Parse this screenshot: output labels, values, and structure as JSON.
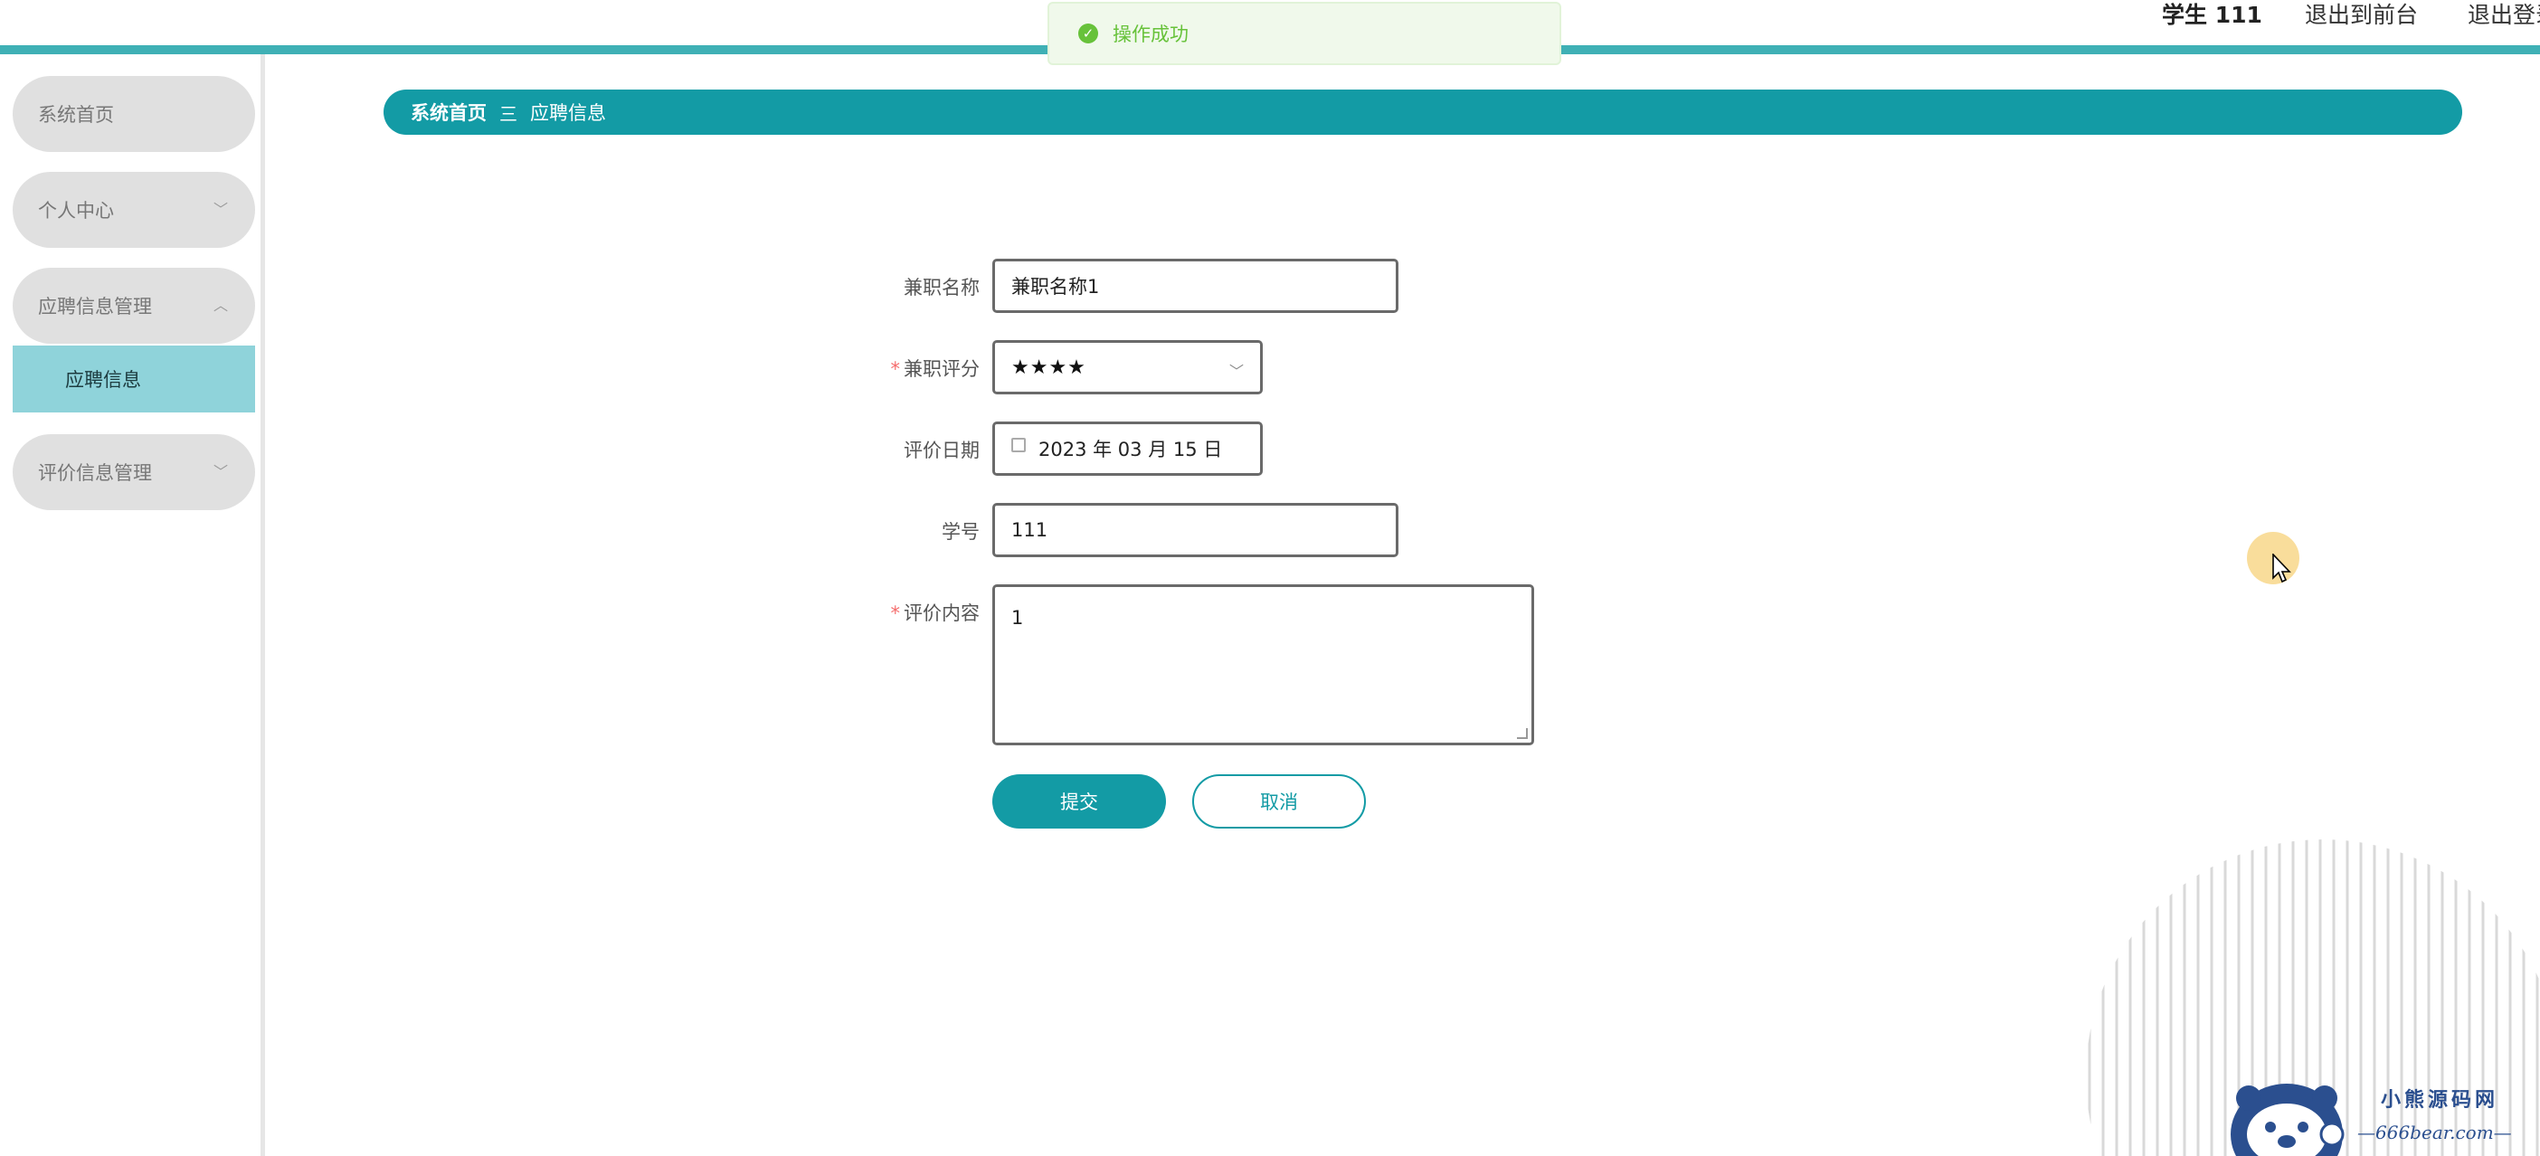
{
  "header": {
    "user_name": "学生 111",
    "to_front_label": "退出到前台",
    "logout_label": "退出登录"
  },
  "toast": {
    "message": "操作成功"
  },
  "sidebar": {
    "items": [
      {
        "label": "系统首页"
      },
      {
        "label": "个人中心"
      },
      {
        "label": "应聘信息管理"
      },
      {
        "label": "评价信息管理"
      }
    ],
    "active_sub": "应聘信息"
  },
  "breadcrumb": {
    "home": "系统首页",
    "separator": "三",
    "current": "应聘信息"
  },
  "form": {
    "job_name_label": "兼职名称",
    "job_name_value": "兼职名称1",
    "score_label": "兼职评分",
    "score_value": "★★★★",
    "date_label": "评价日期",
    "date_value": "2023 年 03 月 15 日",
    "student_id_label": "学号",
    "student_id_value": "111",
    "content_label": "评价内容",
    "content_value": "1",
    "required_mark": "*",
    "submit_label": "提交",
    "cancel_label": "取消"
  },
  "watermark": {
    "title": "小熊源码网",
    "url": "—666bear.com—"
  },
  "colors": {
    "accent": "#139ba5",
    "active_bg": "#8fd3da",
    "success": "#67c23a"
  }
}
